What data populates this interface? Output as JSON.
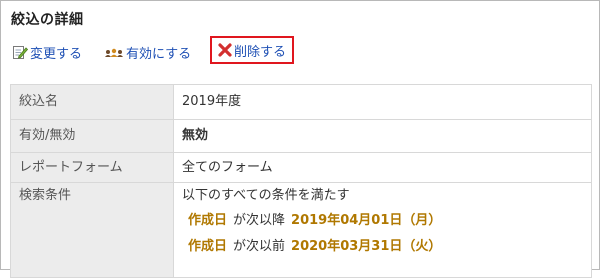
{
  "page": {
    "title": "絞込の詳細"
  },
  "actions": {
    "edit_label": "変更する",
    "enable_label": "有効にする",
    "delete_label": "削除する"
  },
  "details": {
    "name": {
      "label": "絞込名",
      "value": "2019年度"
    },
    "status": {
      "label": "有効/無効",
      "value": "無効"
    },
    "report_form": {
      "label": "レポートフォーム",
      "value": "全てのフォーム"
    },
    "conditions": {
      "label": "検索条件",
      "summary": "以下のすべての条件を満たす",
      "items": [
        {
          "field": "作成日",
          "operator": "が次以降",
          "value": "2019年04月01日（月）"
        },
        {
          "field": "作成日",
          "operator": "が次以前",
          "value": "2020年03月31日（火）"
        }
      ]
    }
  },
  "colors": {
    "link": "#1d4fb4",
    "highlight_border": "#e0161e",
    "status_inactive": "#e0161e",
    "condition_text": "#b07800",
    "label_background": "#ececec"
  }
}
